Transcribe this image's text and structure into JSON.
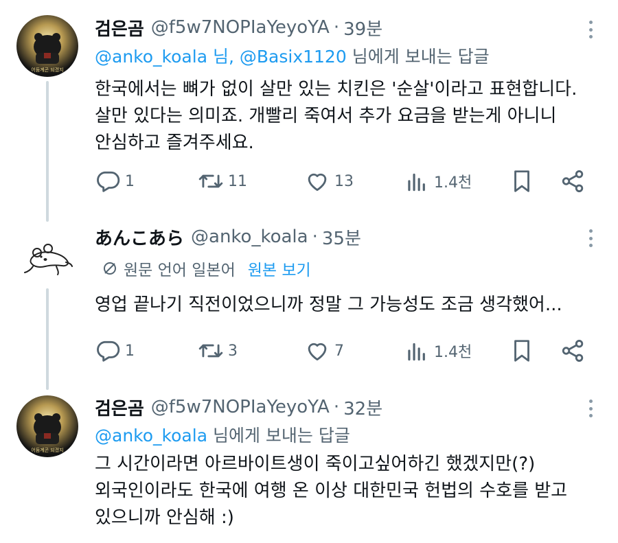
{
  "tweets": [
    {
      "name": "검은곰",
      "handle": "@f5w7NOPIaYeyoYA",
      "separator": "·",
      "time": "39분",
      "reply_prefix": "",
      "reply_mention_1": "@anko_koala 님,",
      "reply_mention_2": "@Basix1120",
      "reply_suffix": "님에게 보내는 답글",
      "avatar_text": "어둠계곤 되겠지",
      "body": [
        "한국에서는 뼈가 없이 살만 있는 치킨은 '순살'이라고 표현합니다.",
        "살만 있다는 의미죠. 개빨리 죽여서 추가 요금을 받는게 아니니",
        "안심하고 즐겨주세요."
      ],
      "counts": {
        "reply": "1",
        "retweet": "11",
        "like": "13",
        "views": "1.4천"
      }
    },
    {
      "name": "あんこあら",
      "handle": "@anko_koala",
      "separator": "·",
      "time": "35분",
      "translate_label": "원문 언어 일본어",
      "translate_link": "원본 보기",
      "body": [
        "영업 끝나기 직전이었으니까 정말 그 가능성도 조금 생각했어..."
      ],
      "counts": {
        "reply": "1",
        "retweet": "3",
        "like": "7",
        "views": "1.4천"
      }
    },
    {
      "name": "검은곰",
      "handle": "@f5w7NOPIaYeyoYA",
      "separator": "·",
      "time": "32분",
      "reply_mention_1": "@anko_koala",
      "reply_suffix": "님에게 보내는 답글",
      "avatar_text": "어둠계곤 되겠지",
      "body": [
        "그 시간이라면 아르바이트생이 죽이고싶어하긴 했겠지만(?)",
        "외국인이라도 한국에 여행 온 이상 대한민국 헌법의 수호를 받고",
        "있으니까 안심해 :)"
      ]
    }
  ],
  "icons": {
    "reply": "reply-icon",
    "retweet": "retweet-icon",
    "like": "heart-icon",
    "views": "views-icon",
    "bookmark": "bookmark-icon",
    "share": "share-icon",
    "more": "more-icon",
    "translate": "translate-icon"
  },
  "colors": {
    "text": "#0f1419",
    "secondary": "#536471",
    "link": "#1d9bf0",
    "thread_line": "#cfd9de"
  }
}
